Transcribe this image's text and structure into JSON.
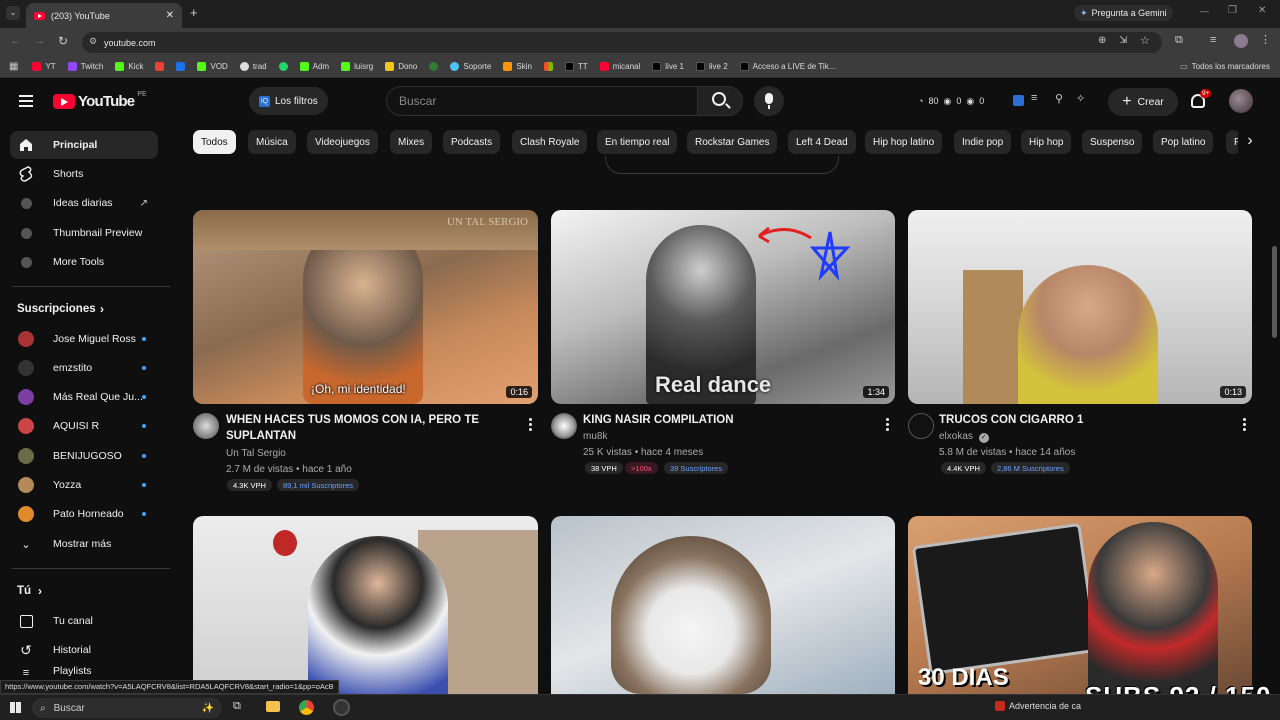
{
  "browser": {
    "tab_title": "(203) YouTube",
    "url": "youtube.com",
    "gemini": "Pregunta a Gemini",
    "bookmarks": [
      "YT",
      "Twitch",
      "Kick",
      "",
      "",
      "VOD",
      "trad",
      "",
      "Adm",
      "luisrg",
      "Dono",
      "",
      "Soporte",
      "Skin",
      "",
      "TT",
      "micanal",
      "live 1",
      "live 2",
      "Acceso a LIVE de Tik..."
    ],
    "all_bookmarks": "Todos los marcadores"
  },
  "masthead": {
    "logo": "YouTube",
    "country": "PE",
    "filters_label": "Los filtros",
    "search_placeholder": "Buscar",
    "stats": [
      "80",
      "0",
      "0"
    ],
    "create": "Crear",
    "notif_count": "9+"
  },
  "sidebar": {
    "main": [
      "Principal",
      "Shorts",
      "Ideas diarias",
      "Thumbnail Preview",
      "More Tools"
    ],
    "subs_header": "Suscripciones",
    "subs": [
      "Jose Miguel Ross",
      "emzstito",
      "Más Real Que Ju...",
      "AQUISI R",
      "BENIJUGOSO",
      "Yozza",
      "Pato Horneado"
    ],
    "show_more": "Mostrar más",
    "you_header": "Tú",
    "you_items": [
      "Tu canal",
      "Historial",
      "Playlists"
    ]
  },
  "chips": [
    "Todos",
    "Música",
    "Videojuegos",
    "Mixes",
    "Podcasts",
    "Clash Royale",
    "En tiempo real",
    "Rockstar Games",
    "Left 4 Dead",
    "Hip hop latino",
    "Indie pop",
    "Hip hop",
    "Suspenso",
    "Pop latino",
    "P"
  ],
  "videos": [
    {
      "title1": "WHEN HACES TUS MOMOS CON IA, PERO TE",
      "title2": "SUPLANTAN",
      "channel": "Un Tal Sergio",
      "meta": "2.7 M de vistas • hace 1 año",
      "duration": "0:16",
      "thumb_caption": "¡Oh, mi identidad!",
      "thumb_tag": "UN TAL SERGIO",
      "pills": [
        "4.3K VPH",
        "89,1 mil Suscriptores"
      ]
    },
    {
      "title1": "KING NASIR COMPILATION",
      "title2": "",
      "channel": "mu8k",
      "meta": "25 K vistas • hace 4 meses",
      "duration": "1:34",
      "thumb_caption": "Real dance",
      "thumb_tag": "",
      "pills": [
        "38 VPH",
        ">100x",
        "39 Suscriptores"
      ]
    },
    {
      "title1": "TRUCOS CON CIGARRO 1",
      "title2": "",
      "channel": "elxokas",
      "meta": "5.8 M de vistas • hace 14 años",
      "duration": "0:13",
      "thumb_caption": "",
      "thumb_tag": "",
      "pills": [
        "4.4K VPH",
        "2,86 M Suscriptores"
      ]
    }
  ],
  "row2": {
    "overlay1": "30 DIAS",
    "overlay2": "SUBS 92 / 150"
  },
  "status_url": "https://www.youtube.com/watch?v=A5LAQFCRV8&list=RDA5LAQFCRV8&start_radio=1&pp=oAcB",
  "taskbar": {
    "search": "Buscar",
    "warning": "Advertencia de ca"
  },
  "colors": {
    "accent": "#ff0033",
    "link": "#3ea6ff"
  }
}
